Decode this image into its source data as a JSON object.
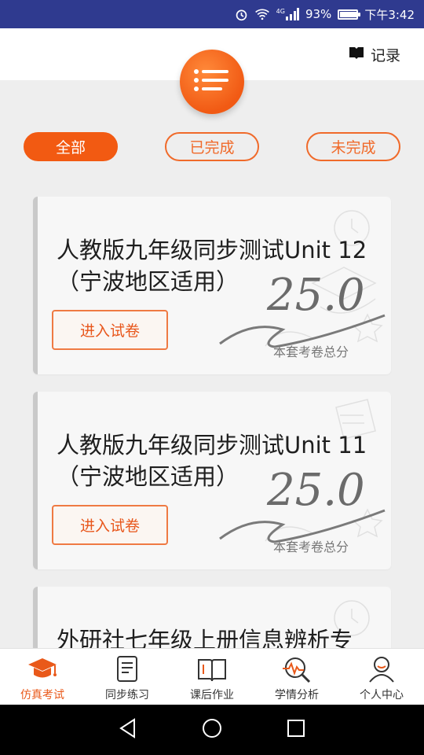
{
  "status_bar": {
    "battery_percent": "93%",
    "time": "下午3:42",
    "network": "4G"
  },
  "header": {
    "record_label": "记录"
  },
  "filters": [
    {
      "label": "全部",
      "active": true
    },
    {
      "label": "已完成",
      "active": false
    },
    {
      "label": "未完成",
      "active": false
    }
  ],
  "papers": [
    {
      "title": "人教版九年级同步测试Unit 12（宁波地区适用）",
      "score": "25.0",
      "score_label": "本套考卷总分",
      "button": "进入试卷"
    },
    {
      "title": "人教版九年级同步测试Unit 11（宁波地区适用）",
      "score": "25.0",
      "score_label": "本套考卷总分",
      "button": "进入试卷"
    },
    {
      "title": "外研社七年级上册信息辨析专",
      "score": "",
      "score_label": "",
      "button": ""
    }
  ],
  "bottom_nav": [
    {
      "label": "仿真考试",
      "icon": "graduation-cap-icon",
      "active": true
    },
    {
      "label": "同步练习",
      "icon": "document-icon",
      "active": false
    },
    {
      "label": "课后作业",
      "icon": "open-book-icon",
      "active": false
    },
    {
      "label": "学情分析",
      "icon": "analysis-magnifier-icon",
      "active": false
    },
    {
      "label": "个人中心",
      "icon": "person-icon",
      "active": false
    }
  ],
  "colors": {
    "accent": "#f25a12",
    "status_bar": "#2f3a8f"
  }
}
